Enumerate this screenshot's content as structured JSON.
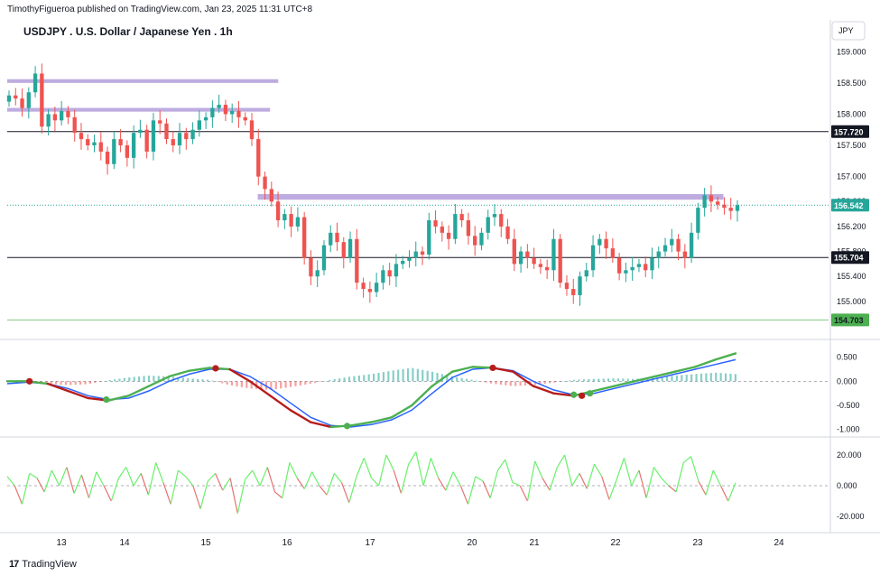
{
  "header": {
    "published": "TimothyFigueroa published on TradingView.com, Jan 23, 2025 11:31 UTC+8",
    "title": "USDJPY . U.S. Dollar / Japanese Yen . 1h",
    "currency": "JPY"
  },
  "footer": {
    "brand": "TradingView",
    "logo": "tv-logo-icon"
  },
  "colors": {
    "up": "#26a69a",
    "down": "#ef5350",
    "zone": "#b39ddb",
    "level": "#131722",
    "green_line": "#4caf50",
    "blue_line": "#2962ff",
    "dark_red": "#b71c1c",
    "osc_green": "#69f06a",
    "osc_red": "#e57373"
  },
  "chart_data": [
    {
      "type": "candlestick",
      "title": "USDJPY . U.S. Dollar / Japanese Yen . 1h",
      "x_ticks": [
        "13",
        "14",
        "15",
        "16",
        "17",
        "20",
        "21",
        "22",
        "23",
        "24"
      ],
      "y_ticks": [
        "159.000",
        "158.500",
        "158.000",
        "157.500",
        "157.000",
        "156.600",
        "156.200",
        "155.800",
        "155.400",
        "155.000"
      ],
      "ylim": [
        154.55,
        159.25
      ],
      "price_labels": [
        "157.720",
        "156.542",
        "155.704",
        "154.703"
      ],
      "levels": [
        157.72,
        155.704
      ],
      "current_price": 156.542,
      "green_level": 154.703,
      "zones": [
        {
          "low": 158.5,
          "high": 158.56,
          "x_start": 0,
          "x_end": 0.33
        },
        {
          "low": 158.04,
          "high": 158.1,
          "x_start": 0,
          "x_end": 0.32
        },
        {
          "low": 156.63,
          "high": 156.72,
          "x_start": 0.305,
          "x_end": 0.872
        }
      ],
      "close": [
        158.3,
        158.25,
        158.1,
        158.35,
        158.65,
        157.8,
        158.0,
        157.9,
        158.05,
        157.95,
        157.7,
        157.6,
        157.5,
        157.55,
        157.4,
        157.2,
        157.6,
        157.5,
        157.3,
        157.7,
        157.75,
        157.4,
        157.9,
        157.85,
        157.6,
        157.5,
        157.7,
        157.6,
        157.75,
        157.9,
        157.95,
        158.1,
        158.15,
        158.0,
        158.05,
        157.95,
        157.9,
        157.6,
        157.0,
        156.8,
        156.6,
        156.3,
        156.4,
        156.2,
        156.35,
        155.7,
        155.4,
        155.5,
        155.9,
        156.1,
        155.95,
        155.7,
        156.0,
        155.3,
        155.2,
        155.15,
        155.3,
        155.5,
        155.4,
        155.6,
        155.65,
        155.7,
        155.8,
        155.75,
        156.3,
        156.2,
        156.1,
        156.0,
        156.4,
        156.3,
        156.05,
        155.9,
        156.1,
        156.35,
        156.4,
        156.2,
        156.0,
        155.6,
        155.8,
        155.7,
        155.6,
        155.55,
        155.5,
        156.0,
        155.3,
        155.2,
        155.1,
        155.4,
        155.5,
        155.9,
        156.0,
        155.85,
        155.7,
        155.45,
        155.5,
        155.55,
        155.6,
        155.5,
        155.7,
        155.8,
        155.9,
        156.0,
        155.8,
        155.7,
        156.1,
        156.5,
        156.7,
        156.6,
        156.55,
        156.5,
        156.45,
        156.542
      ],
      "open": [
        158.2,
        158.3,
        158.25,
        158.1,
        158.35,
        158.65,
        157.8,
        158.0,
        157.9,
        158.05,
        157.95,
        157.7,
        157.6,
        157.5,
        157.55,
        157.4,
        157.2,
        157.6,
        157.5,
        157.3,
        157.7,
        157.75,
        157.4,
        157.9,
        157.85,
        157.6,
        157.5,
        157.7,
        157.6,
        157.75,
        157.9,
        157.95,
        158.1,
        158.15,
        158.0,
        158.05,
        157.95,
        157.9,
        157.6,
        157.0,
        156.8,
        156.6,
        156.3,
        156.4,
        156.2,
        156.35,
        155.7,
        155.4,
        155.5,
        155.9,
        156.1,
        155.95,
        155.7,
        156.0,
        155.3,
        155.2,
        155.15,
        155.3,
        155.5,
        155.4,
        155.6,
        155.65,
        155.7,
        155.8,
        155.75,
        156.3,
        156.2,
        156.1,
        156.0,
        156.4,
        156.3,
        156.05,
        155.9,
        156.1,
        156.35,
        156.4,
        156.2,
        156.0,
        155.6,
        155.8,
        155.7,
        155.6,
        155.55,
        155.5,
        156.0,
        155.3,
        155.2,
        155.1,
        155.4,
        155.5,
        155.9,
        156.0,
        155.85,
        155.7,
        155.45,
        155.5,
        155.55,
        155.6,
        155.5,
        155.7,
        155.8,
        155.9,
        156.0,
        155.8,
        155.7,
        156.1,
        156.5,
        156.7,
        156.6,
        156.55,
        156.5,
        156.45
      ]
    },
    {
      "type": "line",
      "y_ticks": [
        "0.500",
        "0.000",
        "-0.500",
        "-1.000"
      ],
      "ylim": [
        -1.12,
        0.72
      ],
      "series": [
        {
          "color": "#4caf50",
          "values": [
            0.0,
            0.0,
            -0.05,
            -0.2,
            -0.35,
            -0.4,
            -0.3,
            -0.1,
            0.1,
            0.22,
            0.28,
            0.25,
            0.0,
            -0.3,
            -0.6,
            -0.85,
            -0.95,
            -0.92,
            -0.85,
            -0.75,
            -0.5,
            -0.1,
            0.2,
            0.3,
            0.28,
            0.2,
            -0.1,
            -0.25,
            -0.3,
            -0.2,
            -0.1,
            0.0,
            0.1,
            0.2,
            0.3,
            0.45,
            0.58
          ]
        },
        {
          "color": "#2962ff",
          "values": [
            -0.05,
            -0.02,
            -0.05,
            -0.15,
            -0.3,
            -0.38,
            -0.35,
            -0.2,
            0.0,
            0.15,
            0.25,
            0.25,
            0.1,
            -0.15,
            -0.45,
            -0.75,
            -0.92,
            -0.95,
            -0.9,
            -0.8,
            -0.6,
            -0.25,
            0.08,
            0.25,
            0.28,
            0.22,
            0.0,
            -0.18,
            -0.28,
            -0.25,
            -0.15,
            -0.05,
            0.05,
            0.15,
            0.25,
            0.35,
            0.45
          ]
        }
      ],
      "histogram": [
        0.02,
        0.03,
        -0.05,
        -0.08,
        -0.06,
        0.02,
        0.08,
        0.12,
        0.1,
        0.06,
        0.03,
        -0.08,
        -0.15,
        -0.18,
        -0.12,
        -0.05,
        0.03,
        0.1,
        0.15,
        0.22,
        0.28,
        0.2,
        0.1,
        0.03,
        -0.05,
        -0.1,
        -0.08,
        -0.03,
        0.03,
        0.05,
        0.06,
        0.05,
        0.08,
        0.12,
        0.15,
        0.18,
        0.15
      ],
      "markers": [
        {
          "x": 1.1,
          "y": 0.0,
          "color": "#b71c1c"
        },
        {
          "x": 4.9,
          "y": -0.38,
          "color": "#4caf50"
        },
        {
          "x": 10.3,
          "y": 0.27,
          "color": "#b71c1c"
        },
        {
          "x": 16.8,
          "y": -0.93,
          "color": "#4caf50"
        },
        {
          "x": 24.0,
          "y": 0.28,
          "color": "#b71c1c"
        },
        {
          "x": 28.0,
          "y": -0.28,
          "color": "#4caf50"
        },
        {
          "x": 28.4,
          "y": -0.3,
          "color": "#b71c1c"
        },
        {
          "x": 28.8,
          "y": -0.25,
          "color": "#4caf50"
        }
      ]
    },
    {
      "type": "line",
      "y_ticks": [
        "20.000",
        "0.000",
        "-20.000"
      ],
      "ylim": [
        -27,
        27
      ],
      "series": [
        {
          "name": "",
          "color": "#69f06a",
          "values": [
            6,
            0,
            -12,
            8,
            5,
            -4,
            10,
            0,
            12,
            -5,
            7,
            -8,
            9,
            0,
            -10,
            5,
            12,
            0,
            8,
            -6,
            15,
            2,
            -12,
            10,
            6,
            0,
            -15,
            3,
            8,
            -3,
            5,
            -18,
            4,
            10,
            0,
            12,
            -4,
            -8,
            15,
            5,
            -2,
            9,
            0,
            -6,
            8,
            2,
            -11,
            6,
            18,
            5,
            0,
            20,
            10,
            -5,
            14,
            22,
            0,
            18,
            5,
            -3,
            9,
            0,
            -12,
            6,
            3,
            -8,
            10,
            17,
            2,
            0,
            -10,
            16,
            5,
            -3,
            12,
            20,
            0,
            8,
            -2,
            14,
            6,
            -9,
            4,
            18,
            0,
            10,
            -8,
            12,
            5,
            0,
            -4,
            15,
            19,
            3,
            -6,
            10,
            0,
            -10,
            2
          ]
        }
      ]
    }
  ]
}
